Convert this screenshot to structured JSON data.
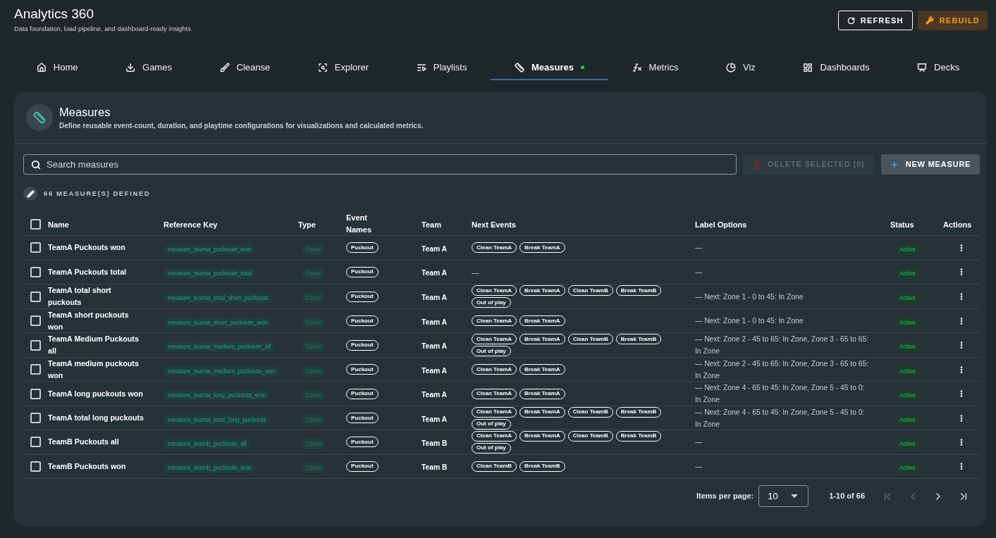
{
  "header": {
    "title": "Analytics 360",
    "subtitle": "Data foundation, load pipeline, and dashboard-ready insights.",
    "buttons": [
      {
        "label": "REFRESH",
        "kind": "refresh"
      },
      {
        "label": "REBUILD",
        "kind": "rebuild"
      }
    ]
  },
  "tabs": [
    {
      "label": "Home",
      "selected": false,
      "dot": false
    },
    {
      "label": "Games",
      "selected": false,
      "dot": false
    },
    {
      "label": "Cleanse",
      "selected": false,
      "dot": false
    },
    {
      "label": "Explorer",
      "selected": false,
      "dot": false
    },
    {
      "label": "Playlists",
      "selected": false,
      "dot": false
    },
    {
      "label": "Measures",
      "selected": true,
      "dot": true
    },
    {
      "label": "Metrics",
      "selected": false,
      "dot": false
    },
    {
      "label": "Viz",
      "selected": false,
      "dot": false
    },
    {
      "label": "Dashboards",
      "selected": false,
      "dot": false
    },
    {
      "label": "Decks",
      "selected": false,
      "dot": false
    }
  ],
  "panel": {
    "title": "Measures",
    "description": "Define reusable event-count, duration, and playtime configurations for visualizations and calculated metrics.",
    "search": {
      "placeholder": "Search measures"
    },
    "actions": [
      {
        "label": "DELETE SELECTED (0)",
        "kind": "delete",
        "disabled": true
      },
      {
        "label": "NEW MEASURE",
        "kind": "create",
        "disabled": false
      }
    ],
    "count_label": "66 MEASURE(S) DEFINED",
    "table": {
      "select_all_checked": false,
      "columns": [
        "Name",
        "Reference Key",
        "Type",
        "Event Names",
        "Team",
        "Next Events",
        "Label Options",
        "Status",
        "Actions"
      ],
      "rows": [
        {
          "checked": false,
          "name": "TeamA Puckouts won",
          "reference_key": "measure_teama_puckouts_won",
          "type": "Count",
          "event_names": [
            "Puckout"
          ],
          "team": "Team A",
          "next_events": [
            "Clean TeamA",
            "Break TeamA"
          ],
          "label_options": "—",
          "status": "Active"
        },
        {
          "checked": false,
          "name": "TeamA Puckouts total",
          "reference_key": "measure_teama_puckouts_total",
          "type": "Count",
          "event_names": [
            "Puckout"
          ],
          "team": "Team A",
          "next_events": "—",
          "label_options": "—",
          "status": "Active"
        },
        {
          "checked": false,
          "name": "TeamA total short puckouts",
          "reference_key": "measure_teama_total_short_puckouts",
          "type": "Count",
          "event_names": [
            "Puckout"
          ],
          "team": "Team A",
          "next_events": [
            "Clean TeamA",
            "Break TeamA",
            "Clean TeamB",
            "Break TeamB",
            "Out of play"
          ],
          "label_options": "— Next: Zone 1 - 0 to 45: In Zone",
          "status": "Active"
        },
        {
          "checked": false,
          "name": "TeamA short puckouts won",
          "reference_key": "measure_teama_short_puckouts_won",
          "type": "Count",
          "event_names": [
            "Puckout"
          ],
          "team": "Team A",
          "next_events": [
            "Clean TeamA",
            "Break TeamA"
          ],
          "label_options": "— Next: Zone 1 - 0 to 45: In Zone",
          "status": "Active"
        },
        {
          "checked": false,
          "name": "TeamA Medium Puckouts all",
          "reference_key": "measure_teama_medium_puckouts_all",
          "type": "Count",
          "event_names": [
            "Puckout"
          ],
          "team": "Team A",
          "next_events": [
            "Clean TeamA",
            "Break TeamA",
            "Clean TeamB",
            "Break TeamB",
            "Out of play"
          ],
          "label_options": "— Next: Zone 2 - 45 to 65: In Zone, Zone 3 - 65 to 65: In Zone",
          "status": "Active"
        },
        {
          "checked": false,
          "name": "TeamA medium puckouts won",
          "reference_key": "measure_teama_medium_puckouts_won",
          "type": "Count",
          "event_names": [
            "Puckout"
          ],
          "team": "Team A",
          "next_events": [
            "Clean TeamA",
            "Break TeamA"
          ],
          "label_options": "— Next: Zone 2 - 45 to 65: In Zone, Zone 3 - 65 to 65: In Zone",
          "status": "Active"
        },
        {
          "checked": false,
          "name": "TeamA long puckouts won",
          "reference_key": "measure_teama_long_puckouts_won",
          "type": "Count",
          "event_names": [
            "Puckout"
          ],
          "team": "Team A",
          "next_events": [
            "Clean TeamA",
            "Break TeamA"
          ],
          "label_options": "— Next: Zone 4 - 65 to 45: In Zone, Zone 5 - 45 to 0: In Zone",
          "status": "Active"
        },
        {
          "checked": false,
          "name": "TeamA total long puckouts",
          "reference_key": "measure_teama_total_long_puckouts",
          "type": "Count",
          "event_names": [
            "Puckout"
          ],
          "team": "Team A",
          "next_events": [
            "Clean TeamA",
            "Break TeamA",
            "Clean TeamB",
            "Break TeamB",
            "Out of play"
          ],
          "label_options": "— Next: Zone 4 - 65 to 45: In Zone, Zone 5 - 45 to 0: In Zone",
          "status": "Active"
        },
        {
          "checked": false,
          "name": "TeamB Puckouts all",
          "reference_key": "measure_teamb_puckouts_all",
          "type": "Count",
          "event_names": [
            "Puckout"
          ],
          "team": "Team B",
          "next_events": [
            "Clean TeamA",
            "Break TeamA",
            "Clean TeamB",
            "Break TeamB",
            "Out of play"
          ],
          "label_options": "—",
          "status": "Active"
        },
        {
          "checked": false,
          "name": "TeamB Puckouts won",
          "reference_key": "measure_teamb_puckouts_won",
          "type": "Count",
          "event_names": [
            "Puckout"
          ],
          "team": "Team B",
          "next_events": [
            "Clean TeamB",
            "Break TeamB"
          ],
          "label_options": "—",
          "status": "Active"
        }
      ]
    },
    "pagination": {
      "items_per_page_label": "Items per page:",
      "items_per_page": "10",
      "range": "1-10 of 66",
      "buttons": [
        {
          "kind": "first",
          "disabled": true
        },
        {
          "kind": "previous",
          "disabled": true
        },
        {
          "kind": "next",
          "disabled": false
        },
        {
          "kind": "last",
          "disabled": false
        }
      ]
    }
  }
}
